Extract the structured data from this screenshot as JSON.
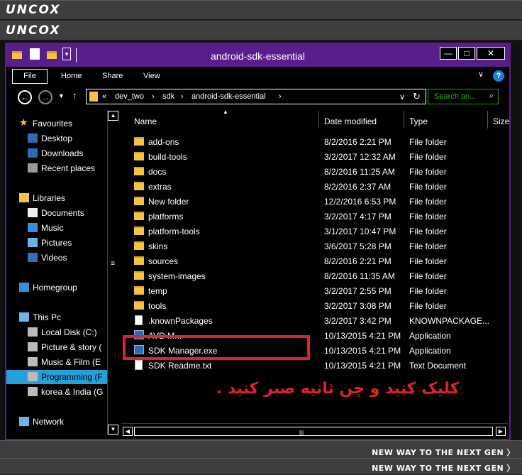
{
  "brand": "UNCOX",
  "tagline": "NEW WAY TO THE NEXT GEN 〉",
  "window": {
    "title": "android-sdk-essential",
    "controls": {
      "minimize": "—",
      "maximize": "□",
      "close": "✕"
    }
  },
  "ribbon": {
    "tabs": [
      "File",
      "Home",
      "Share",
      "View"
    ],
    "expand_icon": "∨",
    "help_label": "?"
  },
  "address": {
    "crumbs": [
      "«",
      "dev_two",
      "›",
      "sdk",
      "›",
      "android-sdk-essential",
      "›"
    ],
    "dropdown": "∨",
    "refresh": "↻"
  },
  "search": {
    "placeholder": "Search an...",
    "icon": "⌕"
  },
  "nav": {
    "items": [
      {
        "label": "Favourites",
        "icon": "star-icon"
      },
      {
        "label": "Desktop",
        "icon": "desktop-icon"
      },
      {
        "label": "Downloads",
        "icon": "downloads-icon"
      },
      {
        "label": "Recent places",
        "icon": "recent-places-icon"
      },
      {
        "label": "Libraries",
        "icon": "libraries-icon"
      },
      {
        "label": "Documents",
        "icon": "documents-icon"
      },
      {
        "label": "Music",
        "icon": "music-icon"
      },
      {
        "label": "Pictures",
        "icon": "pictures-icon"
      },
      {
        "label": "Videos",
        "icon": "videos-icon"
      },
      {
        "label": "Homegroup",
        "icon": "homegroup-icon"
      },
      {
        "label": "This Pc",
        "icon": "computer-icon"
      },
      {
        "label": "Local Disk (C:)",
        "icon": "drive-icon"
      },
      {
        "label": "Picture & story (",
        "icon": "drive-icon"
      },
      {
        "label": "Music & Film (E",
        "icon": "drive-icon"
      },
      {
        "label": "Programming (F",
        "icon": "drive-icon",
        "selected": true
      },
      {
        "label": "korea & India (G",
        "icon": "drive-icon"
      },
      {
        "label": "Network",
        "icon": "network-icon"
      }
    ]
  },
  "columns": {
    "name": "Name",
    "date": "Date modified",
    "type": "Type",
    "size": "Size"
  },
  "files": [
    {
      "name": "add-ons",
      "date": "8/2/2016 2:21 PM",
      "type": "File folder",
      "kind": "folder"
    },
    {
      "name": "build-tools",
      "date": "3/2/2017 12:32 AM",
      "type": "File folder",
      "kind": "folder"
    },
    {
      "name": "docs",
      "date": "8/2/2016 11:25 AM",
      "type": "File folder",
      "kind": "folder"
    },
    {
      "name": "extras",
      "date": "8/2/2016 2:37 AM",
      "type": "File folder",
      "kind": "folder"
    },
    {
      "name": "New folder",
      "date": "12/2/2016 6:53 PM",
      "type": "File folder",
      "kind": "folder"
    },
    {
      "name": "platforms",
      "date": "3/2/2017 4:17 PM",
      "type": "File folder",
      "kind": "folder"
    },
    {
      "name": "platform-tools",
      "date": "3/1/2017 10:47 PM",
      "type": "File folder",
      "kind": "folder"
    },
    {
      "name": "skins",
      "date": "3/6/2017 5:28 PM",
      "type": "File folder",
      "kind": "folder"
    },
    {
      "name": "sources",
      "date": "8/2/2016 2:21 PM",
      "type": "File folder",
      "kind": "folder"
    },
    {
      "name": "system-images",
      "date": "8/2/2016 11:35 AM",
      "type": "File folder",
      "kind": "folder"
    },
    {
      "name": "temp",
      "date": "3/2/2017 2:55 PM",
      "type": "File folder",
      "kind": "folder"
    },
    {
      "name": "tools",
      "date": "3/2/2017 3:08 PM",
      "type": "File folder",
      "kind": "folder"
    },
    {
      "name": ".knownPackages",
      "date": "3/2/2017 3:42 PM",
      "type": "KNOWNPACKAGE...",
      "kind": "file"
    },
    {
      "name": "AVD M...",
      "date": "10/13/2015 4:21 PM",
      "type": "Application",
      "kind": "app"
    },
    {
      "name": "SDK Manager.exe",
      "date": "10/13/2015 4:21 PM",
      "type": "Application",
      "kind": "app"
    },
    {
      "name": "SDK Readme.txt",
      "date": "10/13/2015 4:21 PM",
      "type": "Text Document",
      "kind": "file"
    }
  ],
  "caption": "کلیک کنید و چن ثانیه صبر کنید .",
  "colors": {
    "accent": "#5a1e8c",
    "highlight": "#e0212a",
    "search": "#1fbf1f",
    "selected": "#26a0da"
  }
}
